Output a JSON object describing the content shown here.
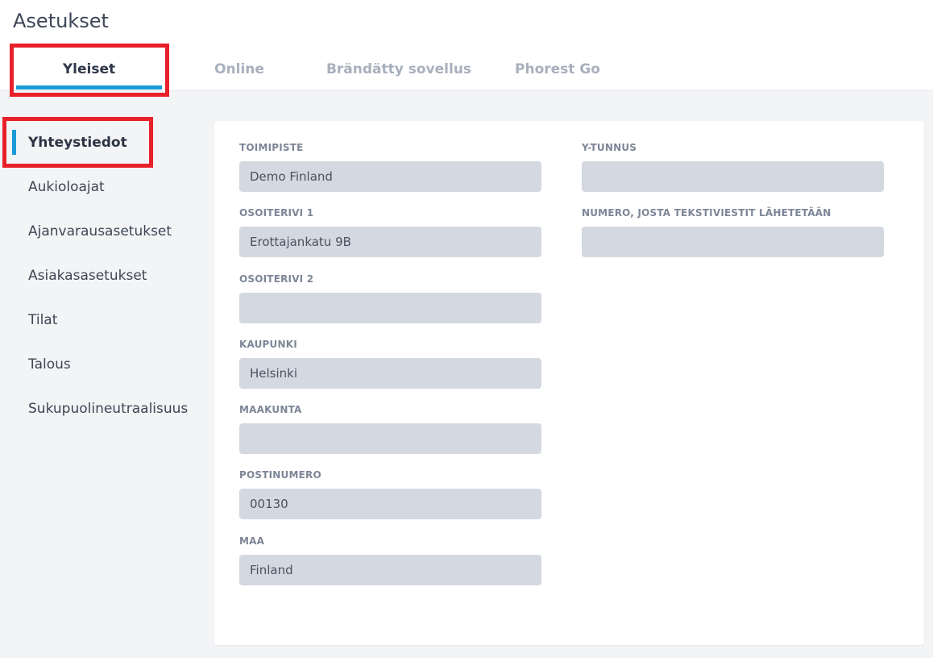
{
  "page": {
    "title": "Asetukset"
  },
  "tabs": [
    {
      "label": "Yleiset",
      "active": true
    },
    {
      "label": "Online"
    },
    {
      "label": "Brändätty sovellus"
    },
    {
      "label": "Phorest Go"
    }
  ],
  "sidebar": {
    "items": [
      {
        "label": "Yhteystiedot",
        "active": true
      },
      {
        "label": "Aukioloajat"
      },
      {
        "label": "Ajanvarausasetukset"
      },
      {
        "label": "Asiakasasetukset"
      },
      {
        "label": "Tilat"
      },
      {
        "label": "Talous"
      },
      {
        "label": "Sukupuolineutraalisuus"
      }
    ]
  },
  "form": {
    "toimipiste": {
      "label": "TOIMIPISTE",
      "value": "Demo Finland"
    },
    "osoiterivi1": {
      "label": "OSOITERIVI 1",
      "value": "Erottajankatu 9B"
    },
    "osoiterivi2": {
      "label": "OSOITERIVI 2",
      "value": ""
    },
    "kaupunki": {
      "label": "KAUPUNKI",
      "value": "Helsinki"
    },
    "maakunta": {
      "label": "MAAKUNTA",
      "value": ""
    },
    "postinumero": {
      "label": "POSTINUMERO",
      "value": "00130"
    },
    "maa": {
      "label": "MAA",
      "value": "Finland"
    },
    "ytunnus": {
      "label": "Y-TUNNUS",
      "value": ""
    },
    "sms_numero": {
      "label": "NUMERO, JOSTA TEKSTIVIESTIT LÄHETETÄÄN",
      "value": ""
    }
  },
  "colors": {
    "accent": "#1a9ad6",
    "highlight": "#e8202a",
    "input_bg": "#d4d8e0"
  }
}
